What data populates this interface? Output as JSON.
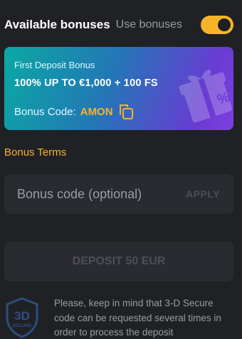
{
  "header": {
    "title": "Available bonuses",
    "use_bonuses_label": "Use bonuses",
    "use_bonuses_enabled": true
  },
  "bonus_card": {
    "subtitle": "First Deposit Bonus",
    "title": "100% UP TO €1,000 + 100 FS",
    "code_label": "Bonus Code:",
    "code_value": "AMON",
    "copy_icon": "copy-icon",
    "decoration_icon": "gift-icon"
  },
  "terms": {
    "label": "Bonus Terms"
  },
  "bonus_code_input": {
    "placeholder": "Bonus code (optional)",
    "value": "",
    "apply_label": "APPLY"
  },
  "deposit": {
    "label": "DEPOSIT 50 EUR"
  },
  "secure": {
    "badge_text": "3D",
    "badge_subtext": "SECURE",
    "note": "Please, keep in mind that 3-D Secure code can be requested several times in order to process the deposit"
  },
  "colors": {
    "background": "#202125",
    "accent": "#f7b429",
    "field": "#2a2b30",
    "muted_text": "#9a9ca3"
  }
}
